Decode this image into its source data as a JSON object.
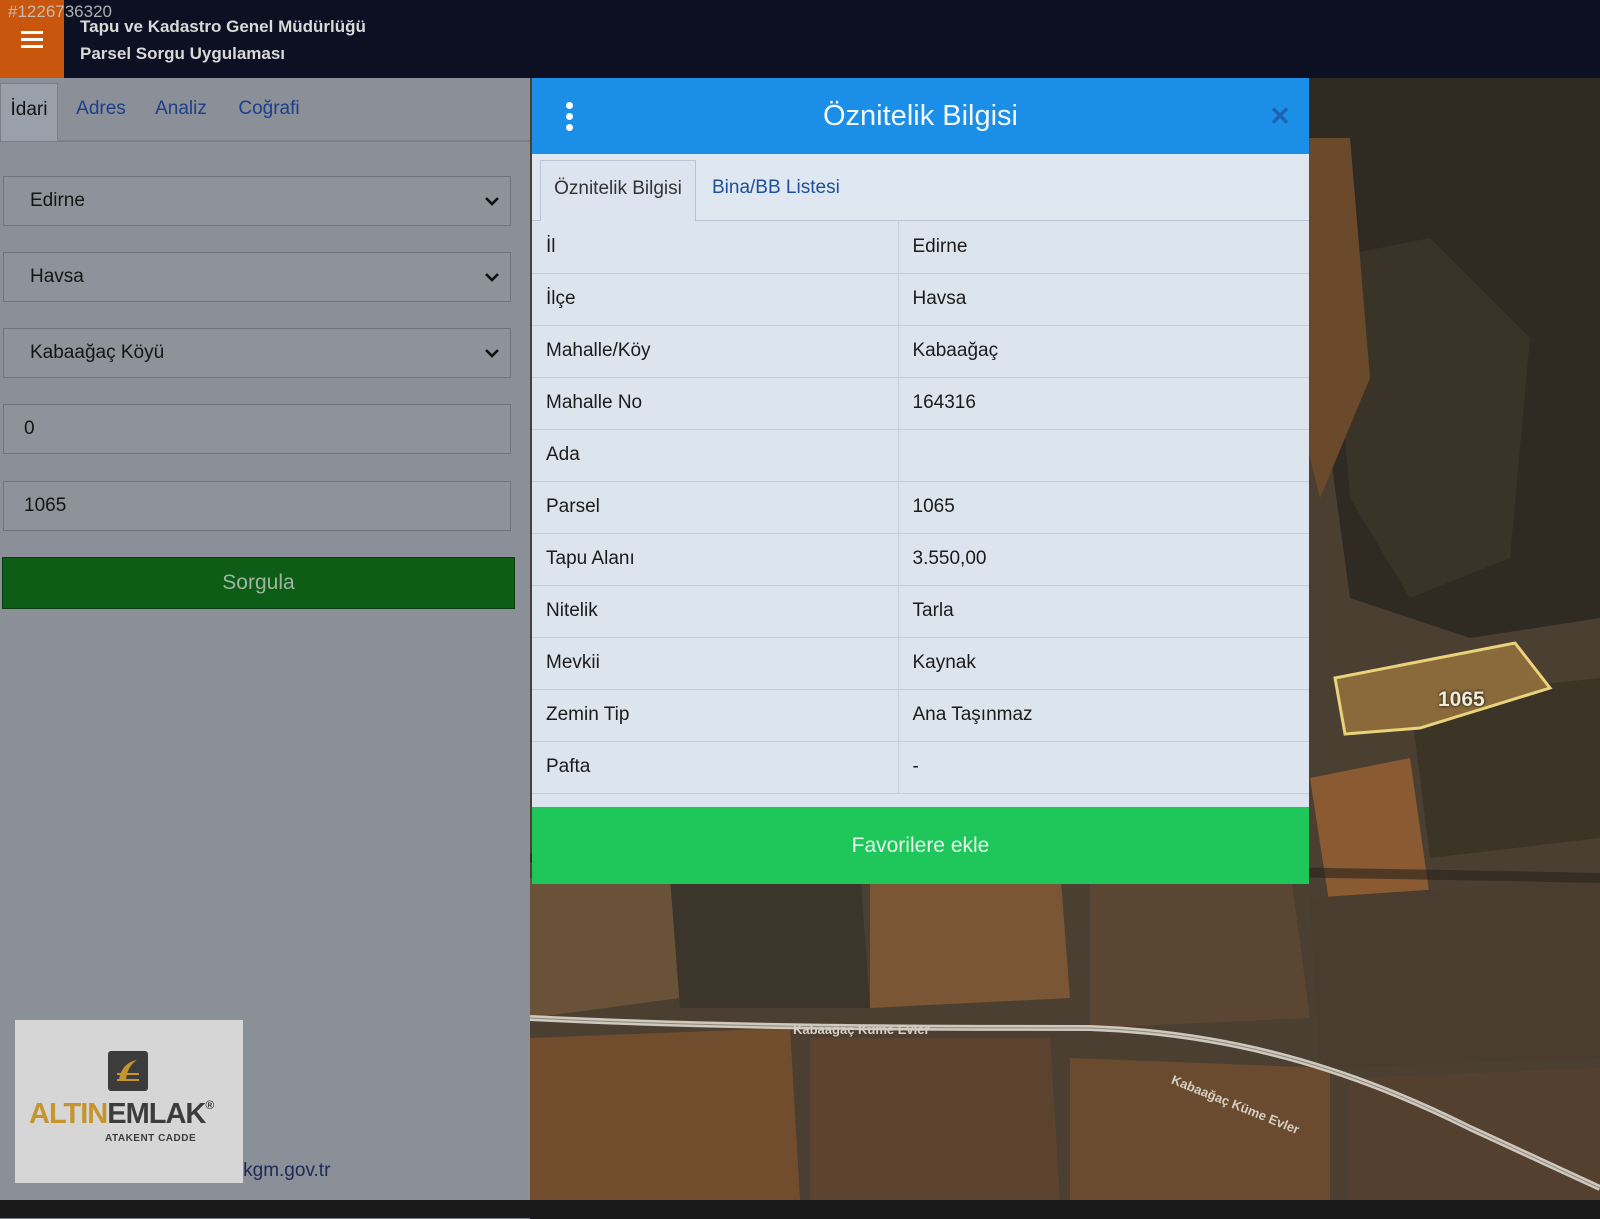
{
  "listing_id": "#1226736320",
  "header": {
    "title_line1": "Tapu ve Kadastro Genel Müdürlüğü",
    "title_line2": "Parsel Sorgu Uygulaması"
  },
  "left_panel": {
    "tabs": [
      "İdari",
      "Adres",
      "Analiz",
      "Coğrafi"
    ],
    "fields": {
      "il": "Edirne",
      "ilce": "Havsa",
      "mahalle": "Kabaağaç Köyü",
      "ada": "0",
      "parsel": "1065"
    },
    "query_button": "Sorgula",
    "email": "cbs@tkgm.gov.tr"
  },
  "logo": {
    "brand_part1": "ALTIN",
    "brand_part2": "EMLAK",
    "reg_mark": "®",
    "subtitle": "ATAKENT CADDE"
  },
  "dialog": {
    "title": "Öznitelik Bilgisi",
    "tabs": [
      "Öznitelik Bilgisi",
      "Bina/BB Listesi"
    ],
    "rows": [
      {
        "key": "İl",
        "value": "Edirne"
      },
      {
        "key": "İlçe",
        "value": "Havsa"
      },
      {
        "key": "Mahalle/Köy",
        "value": "Kabaağaç"
      },
      {
        "key": "Mahalle No",
        "value": "164316"
      },
      {
        "key": "Ada",
        "value": ""
      },
      {
        "key": "Parsel",
        "value": "1065"
      },
      {
        "key": "Tapu Alanı",
        "value": "3.550,00"
      },
      {
        "key": "Nitelik",
        "value": "Tarla"
      },
      {
        "key": "Mevkii",
        "value": "Kaynak"
      },
      {
        "key": "Zemin Tip",
        "value": "Ana Taşınmaz"
      },
      {
        "key": "Pafta",
        "value": "-"
      }
    ],
    "favorite_button": "Favorilere ekle"
  },
  "map": {
    "parcel_label": "1065",
    "road_label_1": "Kabaağaç Küme Evler",
    "road_label_2": "Kabaağaç Küme Evler"
  },
  "colors": {
    "header_bg": "#0d0f22",
    "menu_accent": "#c8570d",
    "dialog_header": "#1b8fe8",
    "query_button": "#0d5d17",
    "favorite_button": "#1fc75b",
    "parcel_outline": "#e8d27a"
  }
}
